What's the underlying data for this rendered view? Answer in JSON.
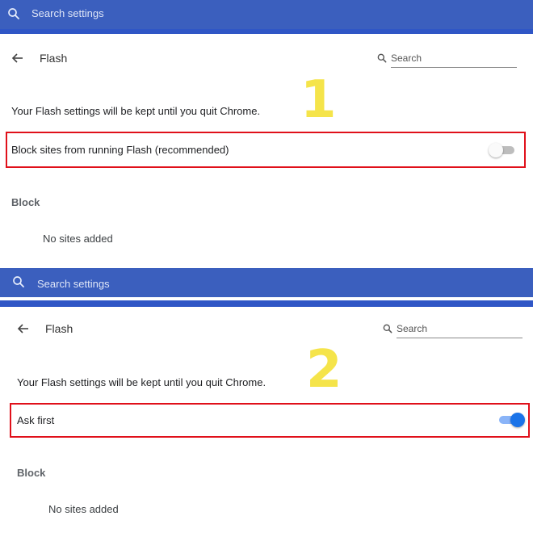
{
  "panels": [
    {
      "topbar": {
        "search_placeholder": "Search settings"
      },
      "header": {
        "title": "Flash",
        "search_placeholder": "Search"
      },
      "info_text": "Your Flash settings will be kept until you quit Chrome.",
      "setting": {
        "label": "Block sites from running Flash (recommended)",
        "enabled": false
      },
      "step_number": "1",
      "block": {
        "label": "Block",
        "empty_text": "No sites added"
      }
    },
    {
      "topbar": {
        "search_placeholder": "Search settings"
      },
      "header": {
        "title": "Flash",
        "search_placeholder": "Search"
      },
      "info_text": "Your Flash settings will be kept until you quit Chrome.",
      "setting": {
        "label": "Ask first",
        "enabled": true
      },
      "step_number": "2",
      "block": {
        "label": "Block",
        "empty_text": "No sites added"
      }
    }
  ],
  "colors": {
    "topbar": "#3b5fbe",
    "highlight_box": "#e0101a",
    "step_number": "#f5e44a",
    "toggle_on": "#1a73e8"
  }
}
